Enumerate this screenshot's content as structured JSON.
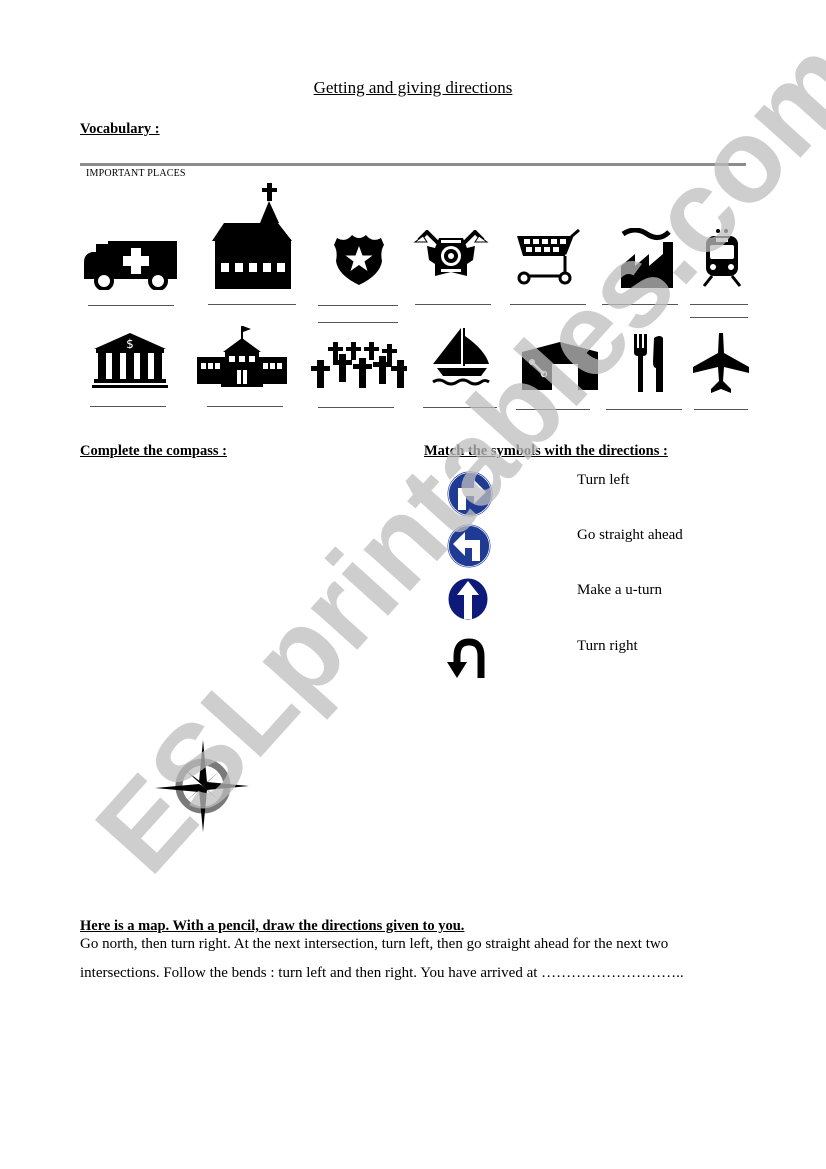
{
  "title": "Getting and giving directions",
  "vocabulary": {
    "heading": "Vocabulary :",
    "section_label": "IMPORTANT PLACES",
    "row1": [
      {
        "icon": "ambulance-icon",
        "meaning": "hospital"
      },
      {
        "icon": "church-icon",
        "meaning": "church"
      },
      {
        "icon": "police-badge-icon",
        "meaning": "police station"
      },
      {
        "icon": "fire-department-icon",
        "meaning": "fire station"
      },
      {
        "icon": "shopping-cart-icon",
        "meaning": "supermarket"
      },
      {
        "icon": "factory-icon",
        "meaning": "factory"
      },
      {
        "icon": "train-icon",
        "meaning": "train station"
      }
    ],
    "row2": [
      {
        "icon": "bank-icon",
        "meaning": "bank"
      },
      {
        "icon": "school-icon",
        "meaning": "school"
      },
      {
        "icon": "cemetery-icon",
        "meaning": "cemetery"
      },
      {
        "icon": "sailboat-icon",
        "meaning": "harbour"
      },
      {
        "icon": "garage-icon",
        "meaning": "garage"
      },
      {
        "icon": "restaurant-icon",
        "meaning": "restaurant"
      },
      {
        "icon": "airplane-icon",
        "meaning": "airport"
      }
    ]
  },
  "compass_section": {
    "heading": "Complete the compass :",
    "icon": "compass-rose-icon"
  },
  "match_section": {
    "heading": "Match the symbols with the directions :",
    "symbols": [
      "turn-right-sign-icon",
      "turn-left-sign-icon",
      "straight-ahead-sign-icon",
      "u-turn-icon"
    ],
    "directions": [
      "Turn left",
      "Go straight ahead",
      "Make a u-turn",
      "Turn right"
    ],
    "sign_color": "#1f3a93",
    "sign_color_dark": "#0d1a7a"
  },
  "map_section": {
    "heading": "Here is a map. With a pencil, draw the directions given to you.",
    "line1": "Go north, then turn right. At the next intersection, turn left, then go straight ahead for the next two",
    "line2": "intersections. Follow the bends : turn left and then right. You have arrived at ……………………….."
  },
  "watermark": "ESLprintables.com"
}
